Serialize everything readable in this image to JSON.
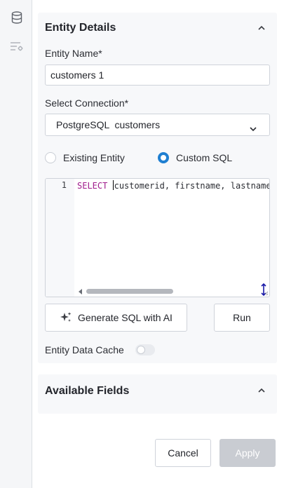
{
  "icons": {
    "database": "database-icon",
    "filter_settings": "filter-settings-icon",
    "chevron_up": "chevron-up-icon",
    "chevron_down": "chevron-down-icon",
    "sparkle": "sparkle-icon",
    "resize": "resize-handle-icon"
  },
  "entity_details": {
    "title": "Entity Details",
    "entity_name_label": "Entity Name*",
    "entity_name_value": "customers 1",
    "connection_label": "Select Connection*",
    "connection_value": "PostgreSQL  customers",
    "radio_existing": "Existing Entity",
    "radio_custom": "Custom SQL",
    "selected_source": "Custom SQL",
    "editor": {
      "line_number": "1",
      "keyword": "SELECT",
      "rest": "customerid, firstname, lastname"
    },
    "generate_button": "Generate SQL with AI",
    "run_button": "Run",
    "cache_label": "Entity Data Cache",
    "cache_enabled": false
  },
  "available_fields": {
    "title": "Available Fields"
  },
  "footer": {
    "cancel": "Cancel",
    "apply": "Apply"
  },
  "colors": {
    "accent": "#1f7fd1",
    "keyword": "#a01c8c",
    "apply_disabled": "#c9ccd2"
  }
}
